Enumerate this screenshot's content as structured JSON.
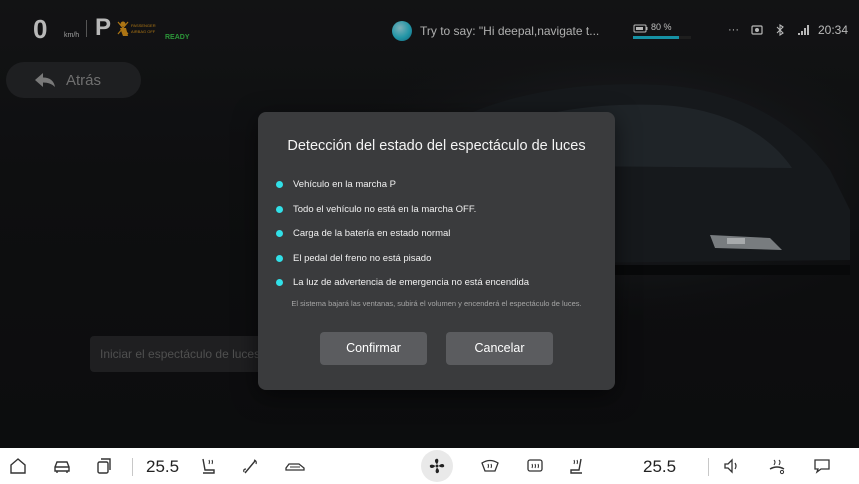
{
  "status": {
    "speed": "0",
    "speed_unit": "km/h",
    "gear": "P",
    "ready": "READY",
    "voice_hint": "Try to say: \"Hi deepal,navigate t...",
    "battery_percent": "80 %",
    "battery_level": 0.8,
    "clock": "20:34",
    "accent_color": "#1fc9e4",
    "ready_color": "#3ccf4e"
  },
  "nav": {
    "back_label": "Atrás"
  },
  "main": {
    "start_placeholder": "Iniciar el espectáculo de luces"
  },
  "dialog": {
    "title": "Detección del estado del espectáculo de luces",
    "conditions": [
      "Vehículo en la marcha P",
      "Todo el vehículo no está en la marcha OFF.",
      "Carga de la batería en estado normal",
      "El pedal del freno no está pisado",
      "La luz de advertencia de emergencia no está encendida"
    ],
    "note": "El sistema bajará las ventanas, subirá el volumen y encenderá el espectáculo de luces.",
    "confirm_label": "Confirmar",
    "cancel_label": "Cancelar",
    "bullet_color": "#31e0e8"
  },
  "dock": {
    "temp_left": "25.5",
    "temp_right": "25.5",
    "icons": [
      "home-icon",
      "car-icon",
      "apps-icon",
      "seat-heat-icon",
      "wiper-icon",
      "car-airflow-icon",
      "fan-icon",
      "windshield-defrost-icon",
      "rear-defrost-icon",
      "seat-ventilation-icon",
      "volume-icon",
      "steering-heat-icon",
      "chat-icon"
    ]
  }
}
